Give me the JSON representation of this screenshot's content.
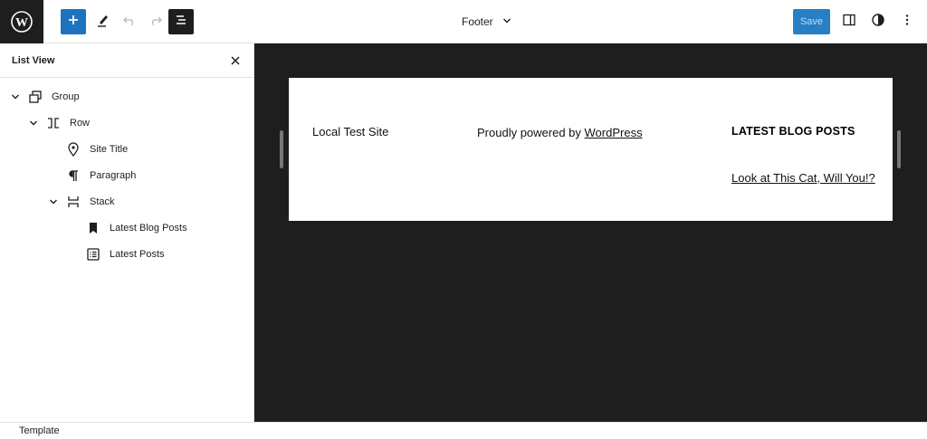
{
  "topbar": {
    "document_title": "Footer",
    "save_label": "Save",
    "icons": [
      "wordpress-icon",
      "plus-icon",
      "pencil-icon",
      "undo-icon",
      "redo-icon",
      "list-view-icon",
      "chevron-down-icon",
      "settings-sidebar-icon",
      "styles-icon",
      "more-vertical-icon"
    ],
    "colors": {
      "add_button": "#1e73be",
      "save_button": "#2780c4",
      "dark": "#1e1e1e"
    }
  },
  "sidebar": {
    "title": "List View",
    "items": [
      {
        "label": "Group",
        "icon": "group-icon",
        "expanded": true
      },
      {
        "label": "Row",
        "icon": "row-icon",
        "expanded": true
      },
      {
        "label": "Site Title",
        "icon": "map-marker-icon"
      },
      {
        "label": "Paragraph",
        "icon": "paragraph-icon"
      },
      {
        "label": "Stack",
        "icon": "stack-icon",
        "expanded": true
      },
      {
        "label": "Latest Blog Posts",
        "icon": "bookmark-icon"
      },
      {
        "label": "Latest Posts",
        "icon": "post-list-icon"
      }
    ]
  },
  "canvas": {
    "site_title": "Local Test Site",
    "powered_prefix": "Proudly powered by ",
    "powered_link": "WordPress",
    "posts_heading": "LATEST BLOG POSTS",
    "post_link": "Look at This Cat, Will You!?"
  },
  "footer": {
    "breadcrumb": "Template"
  }
}
